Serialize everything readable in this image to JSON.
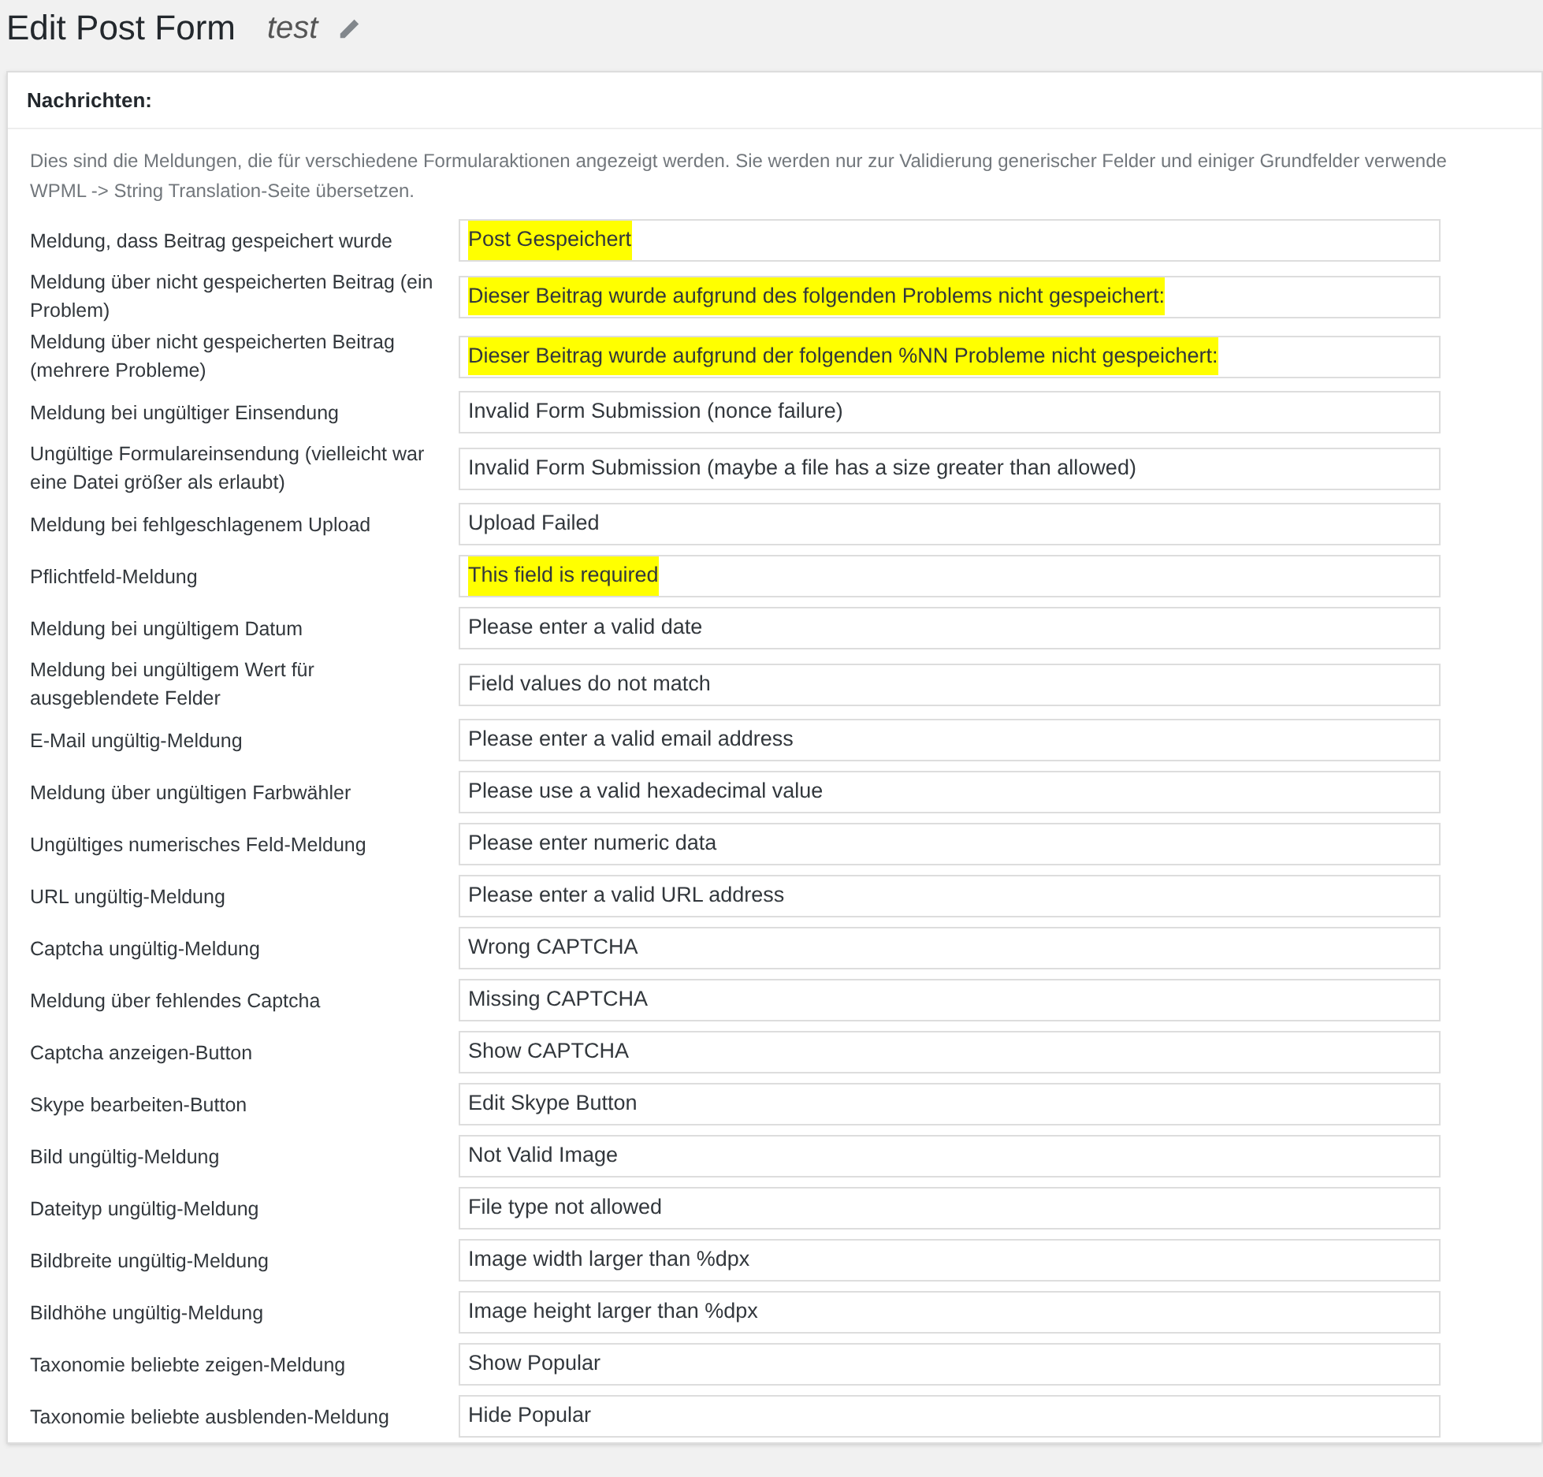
{
  "page_title": "Edit Post Form",
  "form_name": "test",
  "section": {
    "title": "Nachrichten:",
    "description_lines": [
      "Dies sind die Meldungen, die für verschiedene Formularaktionen angezeigt werden. Sie werden nur zur Validierung generischer Felder und einiger Grundfelder verwende",
      "WPML -> String Translation-Seite übersetzen."
    ]
  },
  "messages": [
    {
      "label": "Meldung, dass Beitrag gespeichert wurde",
      "value": "Post Gespeichert",
      "highlighted": true
    },
    {
      "label": "Meldung über nicht gespeicherten Beitrag (ein Problem)",
      "value": "Dieser Beitrag wurde aufgrund des folgenden Problems nicht gespeichert:",
      "highlighted": true
    },
    {
      "label": "Meldung über nicht gespeicherten Beitrag (mehrere Probleme)",
      "value": "Dieser Beitrag wurde aufgrund der folgenden %NN Probleme nicht gespeichert:",
      "highlighted": true
    },
    {
      "label": "Meldung bei ungültiger Einsendung",
      "value": "Invalid Form Submission (nonce failure)",
      "highlighted": false
    },
    {
      "label": "Ungültige Formulareinsendung (vielleicht war eine Datei größer als erlaubt)",
      "value": "Invalid Form Submission (maybe a file has a size greater than allowed)",
      "highlighted": false
    },
    {
      "label": "Meldung bei fehlgeschlagenem Upload",
      "value": "Upload Failed",
      "highlighted": false
    },
    {
      "label": "Pflichtfeld-Meldung",
      "value": "This field is required",
      "highlighted": true
    },
    {
      "label": "Meldung bei ungültigem Datum",
      "value": "Please enter a valid date",
      "highlighted": false
    },
    {
      "label": "Meldung bei ungültigem Wert für ausgeblendete Felder",
      "value": "Field values do not match",
      "highlighted": false
    },
    {
      "label": "E-Mail ungültig-Meldung",
      "value": "Please enter a valid email address",
      "highlighted": false
    },
    {
      "label": "Meldung über ungültigen Farbwähler",
      "value": "Please use a valid hexadecimal value",
      "highlighted": false
    },
    {
      "label": "Ungültiges numerisches Feld-Meldung",
      "value": "Please enter numeric data",
      "highlighted": false
    },
    {
      "label": "URL ungültig-Meldung",
      "value": "Please enter a valid URL address",
      "highlighted": false
    },
    {
      "label": "Captcha ungültig-Meldung",
      "value": "Wrong CAPTCHA",
      "highlighted": false
    },
    {
      "label": "Meldung über fehlendes Captcha",
      "value": "Missing CAPTCHA",
      "highlighted": false
    },
    {
      "label": "Captcha anzeigen-Button",
      "value": "Show CAPTCHA",
      "highlighted": false
    },
    {
      "label": "Skype bearbeiten-Button",
      "value": "Edit Skype Button",
      "highlighted": false
    },
    {
      "label": "Bild ungültig-Meldung",
      "value": "Not Valid Image",
      "highlighted": false
    },
    {
      "label": "Dateityp ungültig-Meldung",
      "value": "File type not allowed",
      "highlighted": false
    },
    {
      "label": "Bildbreite ungültig-Meldung",
      "value": "Image width larger than %dpx",
      "highlighted": false
    },
    {
      "label": "Bildhöhe ungültig-Meldung",
      "value": "Image height larger than %dpx",
      "highlighted": false
    },
    {
      "label": "Taxonomie beliebte zeigen-Meldung",
      "value": "Show Popular",
      "highlighted": false
    },
    {
      "label": "Taxonomie beliebte ausblenden-Meldung",
      "value": "Hide Popular",
      "highlighted": false
    }
  ]
}
